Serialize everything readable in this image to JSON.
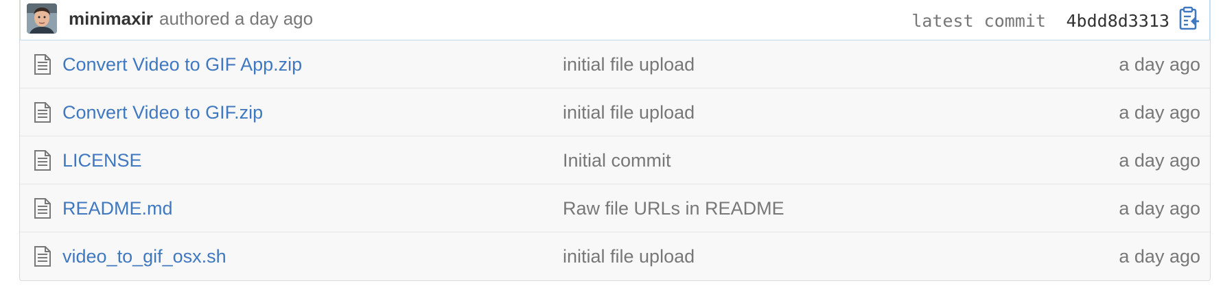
{
  "commit": {
    "author": "minimaxir",
    "meta": "authored a day ago",
    "latest_label": "latest commit",
    "sha": "4bdd8d3313"
  },
  "files": [
    {
      "name": "Convert Video to GIF App.zip",
      "message": "initial file upload",
      "age": "a day ago"
    },
    {
      "name": "Convert Video to GIF.zip",
      "message": "initial file upload",
      "age": "a day ago"
    },
    {
      "name": "LICENSE",
      "message": "Initial commit",
      "age": "a day ago"
    },
    {
      "name": "README.md",
      "message": "Raw file URLs in README",
      "age": "a day ago"
    },
    {
      "name": "video_to_gif_osx.sh",
      "message": "initial file upload",
      "age": "a day ago"
    }
  ],
  "icons": {
    "file": "file-text-icon",
    "copy": "clipboard-icon"
  },
  "colors": {
    "link": "#4078c0",
    "muted": "#777777",
    "text": "#333333",
    "border": "#e5e5e5",
    "commit_border": "#c6dbe9"
  }
}
